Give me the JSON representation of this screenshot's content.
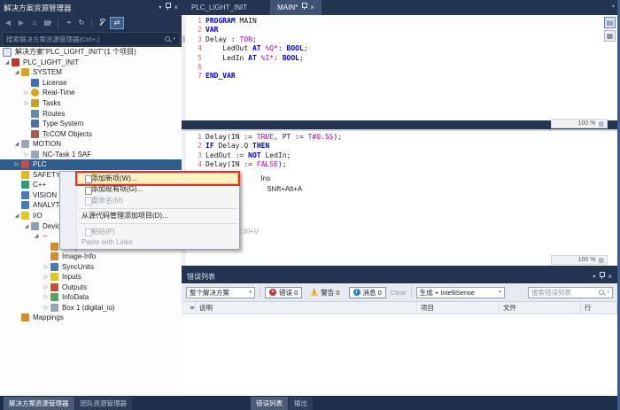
{
  "solution_explorer": {
    "title": "解决方案资源管理器",
    "search_placeholder": "搜索解决方案资源管理器(Ctrl+;)",
    "toolbar": [
      {
        "name": "back-icon",
        "glyph": "◀",
        "dim": true
      },
      {
        "name": "forward-icon",
        "glyph": "▶",
        "dim": true
      },
      {
        "name": "home-icon",
        "glyph": "⌂"
      },
      {
        "name": "collapse-all-icon",
        "glyph": "▤",
        "caret": true
      },
      {
        "name": "separator"
      },
      {
        "name": "pending-changes-filter-icon",
        "glyph": "◔",
        "caret": true
      },
      {
        "name": "sync-icon",
        "glyph": "↻"
      },
      {
        "name": "separator"
      },
      {
        "name": "properties-icon",
        "glyph": "wrench"
      },
      {
        "name": "sync-with-active-document-icon",
        "glyph": "⇄",
        "highlighted": true
      }
    ],
    "tree": [
      {
        "label": "解决方案\"PLC_LIGHT_INIT\"(1 个项目)",
        "level": 0,
        "icon": "solution-icon"
      },
      {
        "label": "PLC_LIGHT_INIT",
        "level": 1,
        "exp": "expanded",
        "icon": "twincat-project-icon"
      },
      {
        "label": "SYSTEM",
        "level": 2,
        "exp": "expanded",
        "icon": "system-icon"
      },
      {
        "label": "License",
        "level": 3,
        "icon": "license-icon"
      },
      {
        "label": "Real-Time",
        "level": 3,
        "exp": "collapsed",
        "icon": "realtime-icon"
      },
      {
        "label": "Tasks",
        "level": 3,
        "exp": "collapsed",
        "icon": "tasks-icon"
      },
      {
        "label": "Routes",
        "level": 3,
        "icon": "routes-icon"
      },
      {
        "label": "Type System",
        "level": 3,
        "icon": "type-system-icon"
      },
      {
        "label": "TcCOM Objects",
        "level": 3,
        "icon": "tccom-objects-icon"
      },
      {
        "label": "MOTION",
        "level": 2,
        "exp": "expanded",
        "icon": "motion-icon"
      },
      {
        "label": "NC-Task 1 SAF",
        "level": 3,
        "exp": "collapsed",
        "icon": "nc-task-icon"
      },
      {
        "label": "PLC",
        "level": 2,
        "exp": "collapsed",
        "icon": "plc-icon",
        "selected": true
      },
      {
        "label": "SAFETY",
        "level": 2,
        "icon": "safety-icon"
      },
      {
        "label": "C++",
        "level": 2,
        "icon": "cpp-icon"
      },
      {
        "label": "VISION",
        "level": 2,
        "icon": "vision-icon"
      },
      {
        "label": "ANALYTICS",
        "level": 2,
        "icon": "analytics-icon"
      },
      {
        "label": "I/O",
        "level": 2,
        "exp": "expanded",
        "icon": "io-icon"
      },
      {
        "label": "Devices",
        "level": 3,
        "exp": "expanded",
        "icon": "devices-icon"
      },
      {
        "label": "",
        "level": 4,
        "exp": "expanded",
        "icon": "device-icon"
      },
      {
        "label": "Image",
        "level": 5,
        "icon": "image-icon"
      },
      {
        "label": "Image-Info",
        "level": 5,
        "icon": "image-info-icon"
      },
      {
        "label": "SyncUnits",
        "level": 5,
        "exp": "collapsed",
        "icon": "syncunits-icon"
      },
      {
        "label": "Inputs",
        "level": 5,
        "exp": "collapsed",
        "icon": "inputs-icon"
      },
      {
        "label": "Outputs",
        "level": 5,
        "exp": "collapsed",
        "icon": "outputs-icon"
      },
      {
        "label": "InfoData",
        "level": 5,
        "exp": "collapsed",
        "icon": "infodata-icon"
      },
      {
        "label": "Box 1 (digital_io)",
        "level": 5,
        "exp": "collapsed",
        "icon": "box-icon"
      },
      {
        "label": "Mappings",
        "level": 2,
        "icon": "mappings-icon"
      }
    ]
  },
  "editor": {
    "tabs": [
      {
        "label": "PLC_LIGHT_INIT",
        "active": false
      },
      {
        "label": "MAIN*",
        "active": true
      }
    ],
    "zoom_label": "100 %",
    "declaration_lines": [
      [
        {
          "c": "k",
          "t": "PROGRAM"
        },
        {
          "c": "p",
          "t": " MAIN"
        }
      ],
      [
        {
          "c": "k",
          "t": "VAR"
        }
      ],
      [
        {
          "c": "p",
          "t": "Delay : "
        },
        {
          "c": "l",
          "t": "TON"
        },
        {
          "c": "p",
          "t": ";"
        }
      ],
      [
        {
          "c": "p",
          "t": "    LedOut "
        },
        {
          "c": "k",
          "t": "AT"
        },
        {
          "c": "p",
          "t": " "
        },
        {
          "c": "l",
          "t": "%Q*"
        },
        {
          "c": "p",
          "t": ": "
        },
        {
          "c": "k",
          "t": "BOOL"
        },
        {
          "c": "p",
          "t": ";"
        }
      ],
      [
        {
          "c": "p",
          "t": "    LedIn "
        },
        {
          "c": "k",
          "t": "AT"
        },
        {
          "c": "p",
          "t": " "
        },
        {
          "c": "l",
          "t": "%I*"
        },
        {
          "c": "p",
          "t": ": "
        },
        {
          "c": "k",
          "t": "BOOL"
        },
        {
          "c": "p",
          "t": ";"
        }
      ],
      [],
      [
        {
          "c": "k",
          "t": "END_VAR"
        }
      ]
    ],
    "implementation_lines": [
      [
        {
          "c": "p",
          "t": "Delay(IN := "
        },
        {
          "c": "l",
          "t": "TRUE"
        },
        {
          "c": "p",
          "t": ", PT := "
        },
        {
          "c": "l",
          "t": "T#0.5S"
        },
        {
          "c": "p",
          "t": ");"
        }
      ],
      [
        {
          "c": "k",
          "t": "IF"
        },
        {
          "c": "p",
          "t": " Delay.Q "
        },
        {
          "c": "k",
          "t": "THEN"
        }
      ],
      [
        {
          "c": "p",
          "t": "LedOut := "
        },
        {
          "c": "k",
          "t": "NOT"
        },
        {
          "c": "p",
          "t": " LedIn;"
        }
      ],
      [
        {
          "c": "p",
          "t": "Delay(IN := "
        },
        {
          "c": "l",
          "t": "FALSE"
        },
        {
          "c": "p",
          "t": ");"
        }
      ],
      [
        {
          "c": "k",
          "t": "END_IF"
        }
      ]
    ]
  },
  "context_menu": {
    "items": [
      {
        "label": "添加新项(W)...",
        "shortcut": "Ins",
        "icon": "add-new-item-icon",
        "highlighted": true,
        "annotated": true
      },
      {
        "label": "添加现有项(G)...",
        "shortcut": "Shift+Alt+A",
        "icon": "add-existing-item-icon"
      },
      {
        "label": "重命名(M)",
        "icon": "rename-icon",
        "disabled": true
      },
      {
        "separator": true
      },
      {
        "label": "从源代码管理添加项目(D)..."
      },
      {
        "separator": true
      },
      {
        "label": "粘贴(P)",
        "shortcut": "Ctrl+V",
        "icon": "paste-icon",
        "disabled": true
      },
      {
        "label": "Paste with Links",
        "disabled": true
      }
    ]
  },
  "error_list": {
    "title": "错误列表",
    "scope_dropdown": "整个解决方案",
    "errors_label": "错误 0",
    "warnings_label": "警告 0",
    "messages_label": "消息 0",
    "clear_label": "Clear",
    "filter_dropdown": "生成 + IntelliSense",
    "search_placeholder": "搜索错误列表",
    "columns": [
      "说明",
      "项目",
      "文件",
      "行"
    ]
  },
  "bottom_tabs": {
    "left": [
      {
        "label": "解决方案资源管理器",
        "active": true
      },
      {
        "label": "团队资源管理器",
        "active": false
      }
    ],
    "right": [
      {
        "label": "错误列表",
        "active": true
      },
      {
        "label": "输出",
        "active": false
      }
    ]
  }
}
